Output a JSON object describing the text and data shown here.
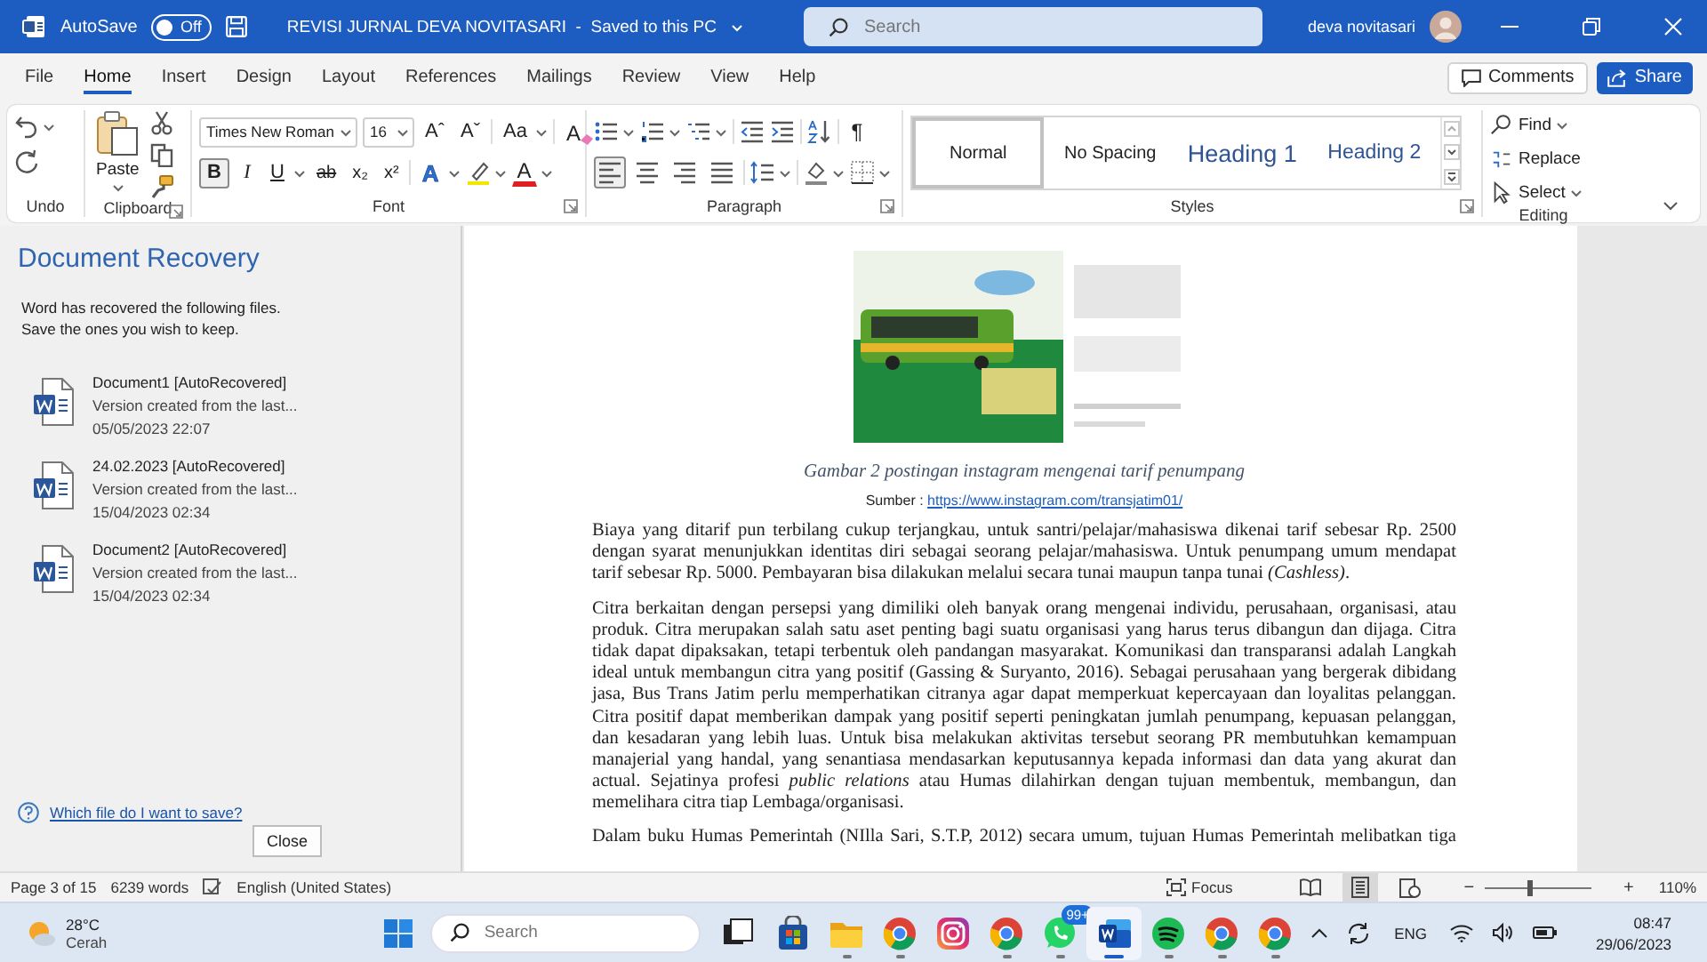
{
  "title_bar": {
    "autosave_label": "AutoSave",
    "autosave": {
      "label": "Off",
      "on": false
    },
    "document_title": "REVISI JURNAL DEVA NOVITASARI  -  Saved to this PC",
    "search_placeholder": "Search",
    "user_name": "deva novitasari"
  },
  "menu_tabs": [
    {
      "label": "File",
      "selected": false
    },
    {
      "label": "Home",
      "selected": true
    },
    {
      "label": "Insert",
      "selected": false
    },
    {
      "label": "Design",
      "selected": false
    },
    {
      "label": "Layout",
      "selected": false
    },
    {
      "label": "References",
      "selected": false
    },
    {
      "label": "Mailings",
      "selected": false
    },
    {
      "label": "Review",
      "selected": false
    },
    {
      "label": "View",
      "selected": false
    },
    {
      "label": "Help",
      "selected": false
    }
  ],
  "comments_button": "Comments",
  "share_button": "Share",
  "ribbon": {
    "undo": {
      "label": "Undo"
    },
    "clipboard": {
      "label": "Clipboard",
      "paste": "Paste"
    },
    "font": {
      "label": "Font",
      "font_name": "Times New Roman",
      "font_size": "16",
      "grow_font": "Aˆ",
      "shrink_font": "Aˇ",
      "change_case": "Aa",
      "clear_formatting": "A",
      "format_buttons": [
        {
          "label": "B",
          "kind": "bold",
          "pressed": true
        },
        {
          "label": "I",
          "kind": "italic",
          "pressed": false
        },
        {
          "label": "U",
          "kind": "underline",
          "pressed": false
        },
        {
          "label": "ab",
          "kind": "strike",
          "pressed": false
        },
        {
          "label": "x₂",
          "kind": "subscript",
          "pressed": false
        },
        {
          "label": "x²",
          "kind": "superscript",
          "pressed": false
        }
      ],
      "text_effects": "A",
      "font_color": "A"
    },
    "paragraph": {
      "label": "Paragraph",
      "pilcrow": "¶",
      "alignments": [
        {
          "kind": "left",
          "selected": true
        },
        {
          "kind": "center",
          "selected": false
        },
        {
          "kind": "right",
          "selected": false
        },
        {
          "kind": "justify",
          "selected": false
        }
      ]
    },
    "styles": {
      "label": "Styles",
      "items": [
        {
          "label": "Normal",
          "kind": "normal",
          "selected": true
        },
        {
          "label": "No Spacing",
          "kind": "plain",
          "selected": false
        },
        {
          "label": "Heading 1",
          "kind": "heading1",
          "selected": false
        },
        {
          "label": "Heading 2",
          "kind": "heading2",
          "selected": false
        }
      ]
    },
    "editing": {
      "label": "Editing",
      "items": [
        {
          "label": "Find",
          "kind": "find"
        },
        {
          "label": "Replace",
          "kind": "replace"
        },
        {
          "label": "Select",
          "kind": "select"
        }
      ]
    }
  },
  "recovery_pane": {
    "title": "Document Recovery",
    "description": "Word has recovered the following files. Save the ones you wish to keep.",
    "files": [
      {
        "name": "Document1  [AutoRecovered]",
        "note": "Version created from the last...",
        "time": "05/05/2023 22:07"
      },
      {
        "name": "24.02.2023  [AutoRecovered]",
        "note": "Version created from the last...",
        "time": "15/04/2023 02:34"
      },
      {
        "name": "Document2  [AutoRecovered]",
        "note": "Version created from the last...",
        "time": "15/04/2023 02:34"
      }
    ],
    "help_link": "Which file do I want to save?",
    "close_button": "Close"
  },
  "document": {
    "figure": {
      "kind": "picture"
    },
    "caption": "Gambar  2 postingan instagram mengenai tarif penumpang",
    "source_label": "Sumber : ",
    "source_link": "https://www.instagram.com/transjatim01/",
    "paragraphs": [
      "Biaya yang ditarif pun terbilang cukup terjangkau, untuk santri/pelajar/mahasiswa dikenai tarif sebesar Rp. 2500 dengan syarat menunjukkan identitas diri sebagai seorang pelajar/mahasiswa. Untuk penumpang umum mendapat tarif sebesar Rp. 5000. Pembayaran bisa dilakukan melalui secara tunai maupun tanpa tunai *(Cashless)*.",
      "Citra berkaitan dengan persepsi yang dimiliki oleh banyak orang mengenai individu, perusahaan, organisasi, atau produk. Citra merupakan salah satu aset penting bagi suatu organisasi yang harus terus dibangun dan dijaga. Citra tidak dapat dipaksakan, tetapi terbentuk oleh pandangan masyarakat. Komunikasi dan transparansi adalah Langkah ideal untuk membangun citra yang positif (Gassing & Suryanto, 2016). Sebagai perusahaan yang bergerak dibidang jasa, Bus Trans Jatim perlu memperhatikan citranya agar dapat memperkuat kepercayaan dan loyalitas pelanggan. Citra positif dapat memberikan dampak yang positif seperti peningkatan jumlah penumpang, kepuasan pelanggan, dan kesadaran yang lebih luas. Untuk bisa melakukan aktivitas tersebut seorang PR membutuhkan kemampuan manajerial yang handal, yang senantiasa mendasarkan keputusannya kepada informasi dan data yang akurat dan actual. Sejatinya profesi *public relations* atau Humas dilahirkan dengan tujuan membentuk, membangun, dan memelihara citra tiap Lembaga/organisasi."
    ],
    "cut_line": "Dalam buku Humas Pemerintah (NIlla Sari, S.T.P, 2012) secara umum, tujuan Humas Pemerintah melibatkan tiga"
  },
  "status_bar": {
    "page": "Page 3 of 15",
    "words": "6239 words",
    "language": "English (United States)",
    "focus": "Focus",
    "zoom_out": "−",
    "zoom_in": "+",
    "zoom": {
      "level": 0.42
    },
    "zoom_label": "110%"
  },
  "taskbar": {
    "temperature": "28°C",
    "weather": "Cerah",
    "search_placeholder": "Search",
    "apps": [
      {
        "kind": "taskview",
        "running": false,
        "selected": false
      },
      {
        "kind": "store",
        "running": false,
        "selected": false
      },
      {
        "kind": "folder",
        "running": true,
        "selected": false
      },
      {
        "kind": "chrome",
        "running": true,
        "selected": false
      },
      {
        "kind": "instagram",
        "running": false,
        "selected": false
      },
      {
        "kind": "chrome",
        "running": true,
        "selected": false
      },
      {
        "kind": "whatsapp",
        "running": true,
        "selected": false,
        "badge": "99+"
      },
      {
        "kind": "word",
        "running": true,
        "selected": true
      },
      {
        "kind": "spotify",
        "running": true,
        "selected": false
      },
      {
        "kind": "chrome",
        "running": true,
        "selected": false
      },
      {
        "kind": "chrome",
        "running": true,
        "selected": false
      }
    ],
    "language": "ENG",
    "time": "08:47",
    "date": "29/06/2023"
  }
}
